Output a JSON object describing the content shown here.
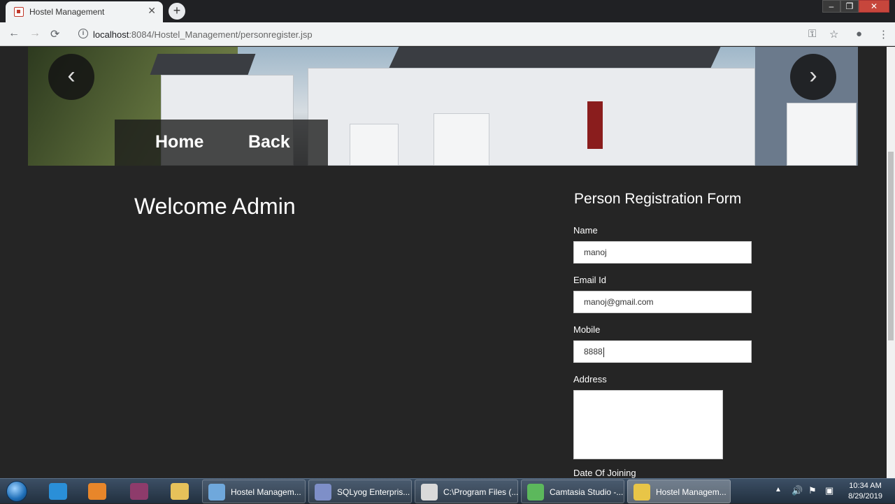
{
  "browser": {
    "tab_title": "Hostel Management",
    "tab_close": "✕",
    "new_tab": "+",
    "url_host": "localhost",
    "url_rest": ":8084/Hostel_Management/personregister.jsp",
    "back": "←",
    "forward": "→",
    "reload": "⟳",
    "info": "i",
    "key_icon": "⚿",
    "star_icon": "☆",
    "account_icon": "●",
    "menu_icon": "⋮",
    "win_min": "–",
    "win_max": "❐",
    "win_close": "✕"
  },
  "hero": {
    "prev_arrow": "‹",
    "next_arrow": "›",
    "nav": [
      {
        "label": "Home"
      },
      {
        "label": "Back"
      }
    ]
  },
  "main": {
    "welcome": "Welcome Admin"
  },
  "form": {
    "title": "Person Registration Form",
    "fields": {
      "name": {
        "label": "Name",
        "value": "manoj"
      },
      "email": {
        "label": "Email Id",
        "value": "manoj@gmail.com"
      },
      "mobile": {
        "label": "Mobile",
        "value": "8888"
      },
      "address": {
        "label": "Address",
        "value": ""
      },
      "doj": {
        "label": "Date Of Joining"
      }
    }
  },
  "taskbar": {
    "tasks": [
      {
        "label": "Hostel Managem...",
        "color": "#6fa8dc"
      },
      {
        "label": "SQLyog Enterpris...",
        "color": "#7e8fc8"
      },
      {
        "label": "C:\\Program Files (...",
        "color": "#d9d9d9"
      },
      {
        "label": "Camtasia Studio -...",
        "color": "#5cb85c"
      },
      {
        "label": "Hostel Managem...",
        "color": "#e8c547"
      }
    ],
    "clock_time": "10:34 AM",
    "clock_date": "8/29/2019",
    "tray_up": "▲",
    "tray_icons": [
      "🔊",
      "⚑",
      "▣"
    ]
  },
  "colors": {
    "page_bg": "#252525",
    "input_bg": "#ffffff"
  }
}
